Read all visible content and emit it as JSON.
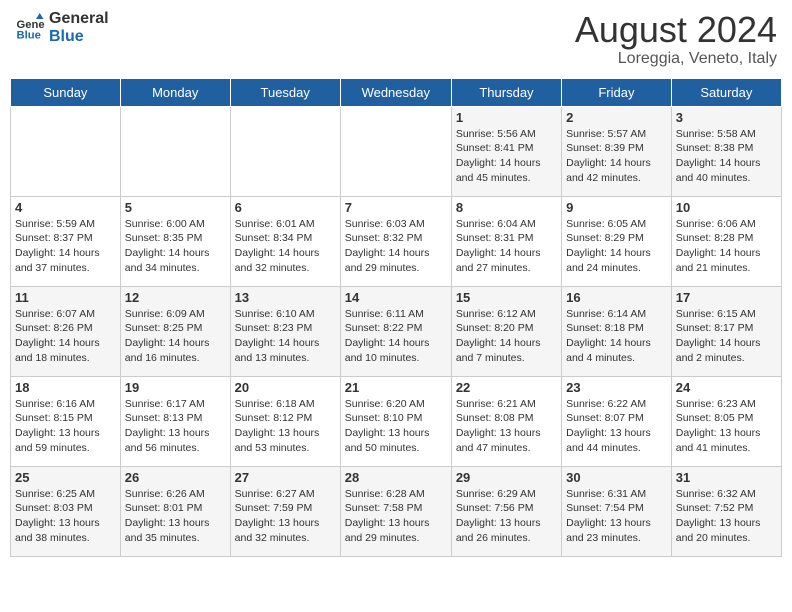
{
  "header": {
    "logo_line1": "General",
    "logo_line2": "Blue",
    "month_year": "August 2024",
    "location": "Loreggia, Veneto, Italy"
  },
  "weekdays": [
    "Sunday",
    "Monday",
    "Tuesday",
    "Wednesday",
    "Thursday",
    "Friday",
    "Saturday"
  ],
  "weeks": [
    [
      {
        "day": "",
        "info": ""
      },
      {
        "day": "",
        "info": ""
      },
      {
        "day": "",
        "info": ""
      },
      {
        "day": "",
        "info": ""
      },
      {
        "day": "1",
        "info": "Sunrise: 5:56 AM\nSunset: 8:41 PM\nDaylight: 14 hours\nand 45 minutes."
      },
      {
        "day": "2",
        "info": "Sunrise: 5:57 AM\nSunset: 8:39 PM\nDaylight: 14 hours\nand 42 minutes."
      },
      {
        "day": "3",
        "info": "Sunrise: 5:58 AM\nSunset: 8:38 PM\nDaylight: 14 hours\nand 40 minutes."
      }
    ],
    [
      {
        "day": "4",
        "info": "Sunrise: 5:59 AM\nSunset: 8:37 PM\nDaylight: 14 hours\nand 37 minutes."
      },
      {
        "day": "5",
        "info": "Sunrise: 6:00 AM\nSunset: 8:35 PM\nDaylight: 14 hours\nand 34 minutes."
      },
      {
        "day": "6",
        "info": "Sunrise: 6:01 AM\nSunset: 8:34 PM\nDaylight: 14 hours\nand 32 minutes."
      },
      {
        "day": "7",
        "info": "Sunrise: 6:03 AM\nSunset: 8:32 PM\nDaylight: 14 hours\nand 29 minutes."
      },
      {
        "day": "8",
        "info": "Sunrise: 6:04 AM\nSunset: 8:31 PM\nDaylight: 14 hours\nand 27 minutes."
      },
      {
        "day": "9",
        "info": "Sunrise: 6:05 AM\nSunset: 8:29 PM\nDaylight: 14 hours\nand 24 minutes."
      },
      {
        "day": "10",
        "info": "Sunrise: 6:06 AM\nSunset: 8:28 PM\nDaylight: 14 hours\nand 21 minutes."
      }
    ],
    [
      {
        "day": "11",
        "info": "Sunrise: 6:07 AM\nSunset: 8:26 PM\nDaylight: 14 hours\nand 18 minutes."
      },
      {
        "day": "12",
        "info": "Sunrise: 6:09 AM\nSunset: 8:25 PM\nDaylight: 14 hours\nand 16 minutes."
      },
      {
        "day": "13",
        "info": "Sunrise: 6:10 AM\nSunset: 8:23 PM\nDaylight: 14 hours\nand 13 minutes."
      },
      {
        "day": "14",
        "info": "Sunrise: 6:11 AM\nSunset: 8:22 PM\nDaylight: 14 hours\nand 10 minutes."
      },
      {
        "day": "15",
        "info": "Sunrise: 6:12 AM\nSunset: 8:20 PM\nDaylight: 14 hours\nand 7 minutes."
      },
      {
        "day": "16",
        "info": "Sunrise: 6:14 AM\nSunset: 8:18 PM\nDaylight: 14 hours\nand 4 minutes."
      },
      {
        "day": "17",
        "info": "Sunrise: 6:15 AM\nSunset: 8:17 PM\nDaylight: 14 hours\nand 2 minutes."
      }
    ],
    [
      {
        "day": "18",
        "info": "Sunrise: 6:16 AM\nSunset: 8:15 PM\nDaylight: 13 hours\nand 59 minutes."
      },
      {
        "day": "19",
        "info": "Sunrise: 6:17 AM\nSunset: 8:13 PM\nDaylight: 13 hours\nand 56 minutes."
      },
      {
        "day": "20",
        "info": "Sunrise: 6:18 AM\nSunset: 8:12 PM\nDaylight: 13 hours\nand 53 minutes."
      },
      {
        "day": "21",
        "info": "Sunrise: 6:20 AM\nSunset: 8:10 PM\nDaylight: 13 hours\nand 50 minutes."
      },
      {
        "day": "22",
        "info": "Sunrise: 6:21 AM\nSunset: 8:08 PM\nDaylight: 13 hours\nand 47 minutes."
      },
      {
        "day": "23",
        "info": "Sunrise: 6:22 AM\nSunset: 8:07 PM\nDaylight: 13 hours\nand 44 minutes."
      },
      {
        "day": "24",
        "info": "Sunrise: 6:23 AM\nSunset: 8:05 PM\nDaylight: 13 hours\nand 41 minutes."
      }
    ],
    [
      {
        "day": "25",
        "info": "Sunrise: 6:25 AM\nSunset: 8:03 PM\nDaylight: 13 hours\nand 38 minutes."
      },
      {
        "day": "26",
        "info": "Sunrise: 6:26 AM\nSunset: 8:01 PM\nDaylight: 13 hours\nand 35 minutes."
      },
      {
        "day": "27",
        "info": "Sunrise: 6:27 AM\nSunset: 7:59 PM\nDaylight: 13 hours\nand 32 minutes."
      },
      {
        "day": "28",
        "info": "Sunrise: 6:28 AM\nSunset: 7:58 PM\nDaylight: 13 hours\nand 29 minutes."
      },
      {
        "day": "29",
        "info": "Sunrise: 6:29 AM\nSunset: 7:56 PM\nDaylight: 13 hours\nand 26 minutes."
      },
      {
        "day": "30",
        "info": "Sunrise: 6:31 AM\nSunset: 7:54 PM\nDaylight: 13 hours\nand 23 minutes."
      },
      {
        "day": "31",
        "info": "Sunrise: 6:32 AM\nSunset: 7:52 PM\nDaylight: 13 hours\nand 20 minutes."
      }
    ]
  ]
}
